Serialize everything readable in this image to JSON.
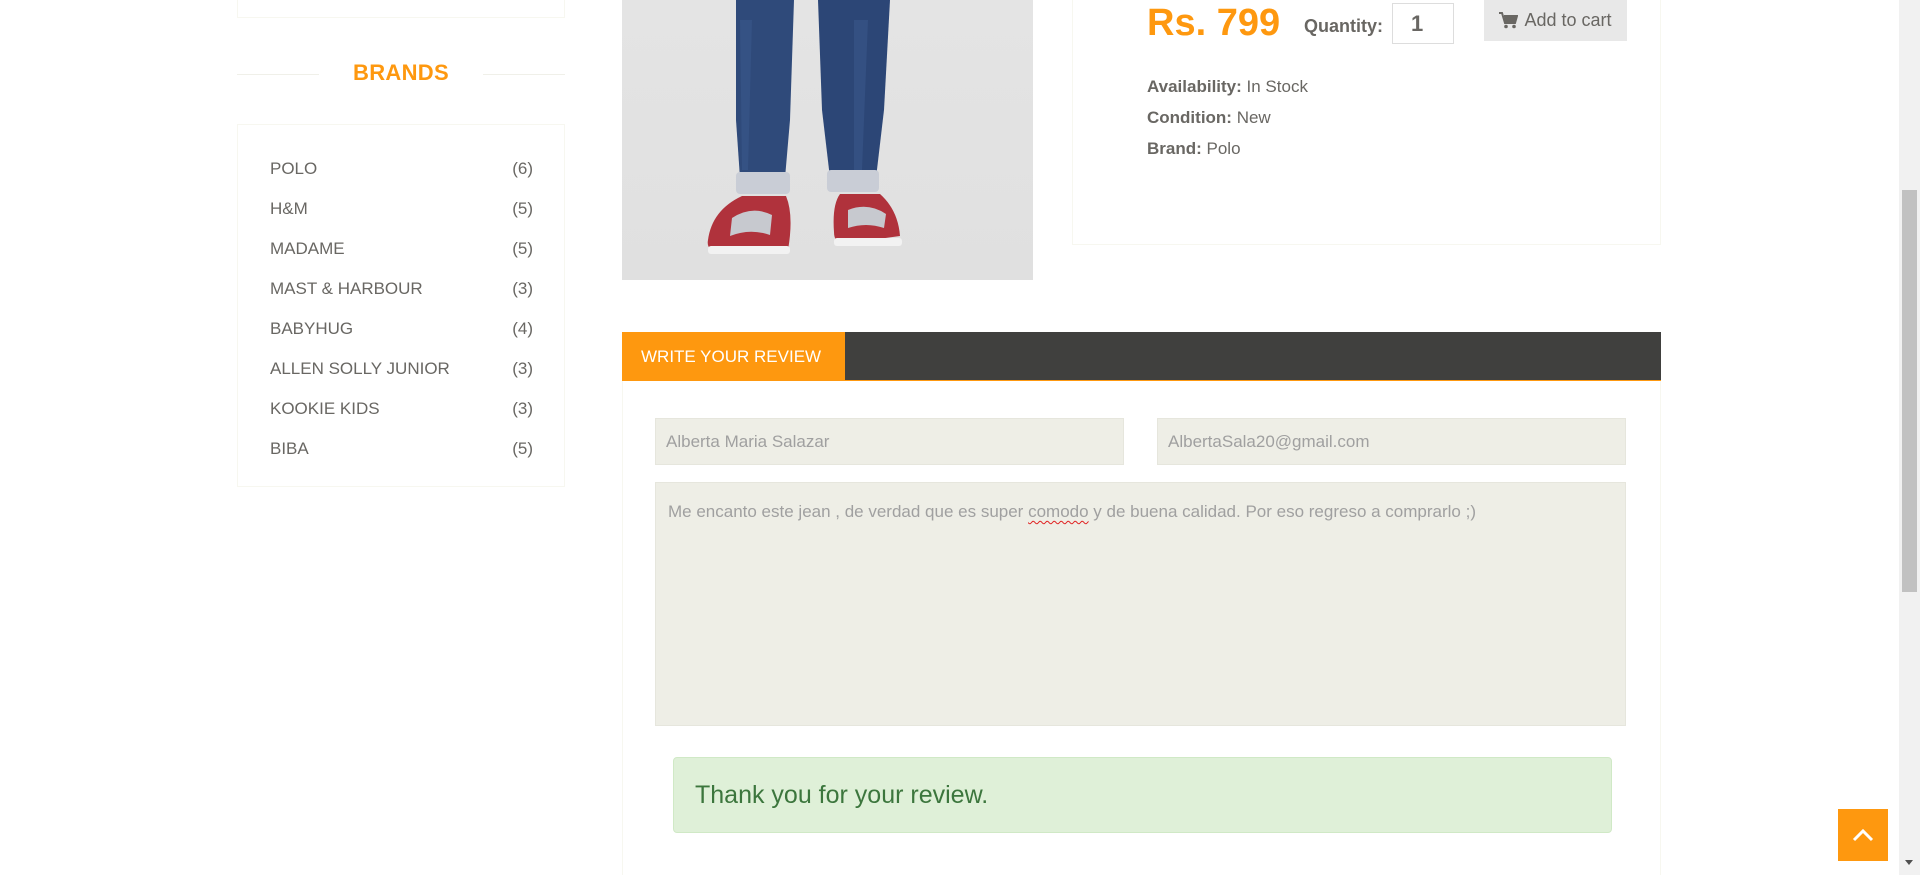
{
  "sidebar": {
    "brands_title": "BRANDS",
    "brands": [
      {
        "name": "POLO",
        "count": "(6)"
      },
      {
        "name": "H&M",
        "count": "(5)"
      },
      {
        "name": "MADAME",
        "count": "(5)"
      },
      {
        "name": "MAST & HARBOUR",
        "count": "(3)"
      },
      {
        "name": "BABYHUG",
        "count": "(4)"
      },
      {
        "name": "ALLEN SOLLY JUNIOR",
        "count": "(3)"
      },
      {
        "name": "KOOKIE KIDS",
        "count": "(3)"
      },
      {
        "name": "BIBA",
        "count": "(5)"
      }
    ]
  },
  "product": {
    "price": "Rs. 799",
    "quantity_label": "Quantity:",
    "quantity_value": "1",
    "add_to_cart_label": "Add to cart",
    "availability_label": "Availability:",
    "availability_value": "In Stock",
    "condition_label": "Condition:",
    "condition_value": "New",
    "brand_label": "Brand:",
    "brand_value": "Polo"
  },
  "review": {
    "tab_label": "WRITE YOUR REVIEW",
    "name_value": "Alberta Maria Salazar",
    "email_value": "AlbertaSala20@gmail.com",
    "message_before": "Me encanto este jean , de verdad que es super ",
    "message_misspelled": "comodo",
    "message_after": " y de buena calidad. Por eso regreso a comprarlo ;)",
    "success_message": "Thank you for your review."
  },
  "icons": {
    "cart": "shopping-cart-icon",
    "scroll_up": "chevron-up-icon"
  },
  "colors": {
    "accent": "#fe980f",
    "dark_bar": "#40403e",
    "success_bg": "#dff0d8",
    "success_text": "#3c763d"
  }
}
